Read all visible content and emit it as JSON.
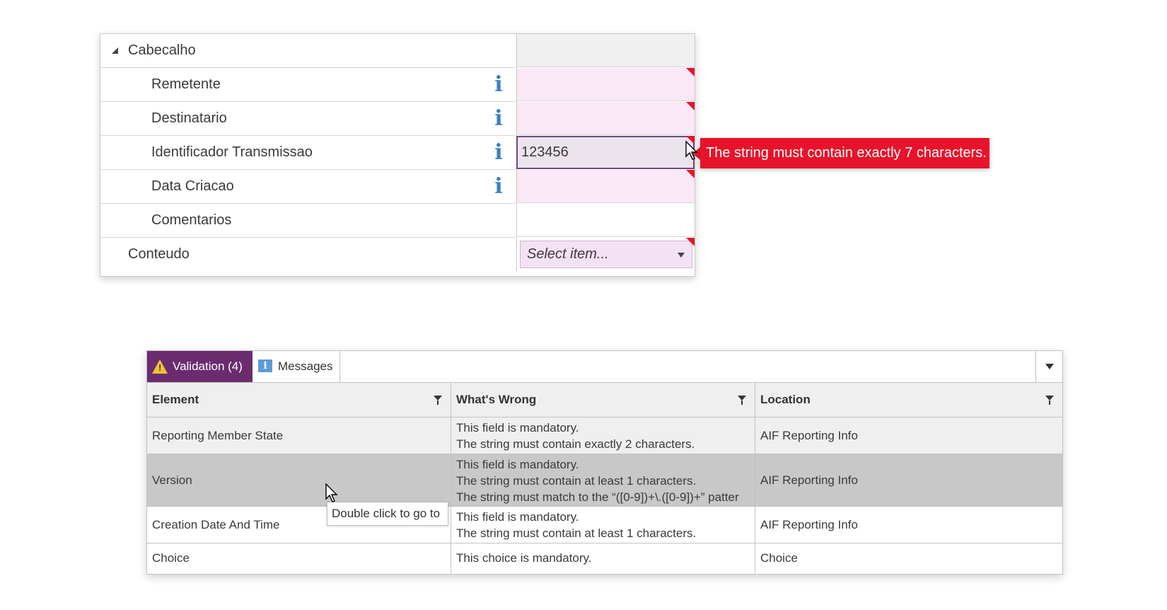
{
  "property_grid": {
    "rows": [
      {
        "label": "Cabecalho",
        "value": ""
      },
      {
        "label": "Remetente",
        "value": ""
      },
      {
        "label": "Destinatario",
        "value": ""
      },
      {
        "label": "Identificador Transmissao",
        "value": "123456"
      },
      {
        "label": "Data Criacao",
        "value": ""
      },
      {
        "label": "Comentarios",
        "value": ""
      },
      {
        "label": "Conteudo",
        "value": ""
      }
    ],
    "combo_placeholder": "Select item...",
    "info_glyph": "i",
    "error_tooltip": "The string must contain exactly 7 characters.",
    "error_color": "#e8132a"
  },
  "validation_panel": {
    "tabs": [
      {
        "label": "Validation (4)",
        "icon": "warning-icon",
        "active": true
      },
      {
        "label": "Messages",
        "icon": "info-icon",
        "active": false
      }
    ],
    "info_glyph": "i",
    "warning_glyph": "!",
    "accent_color": "#6a2c6f",
    "columns": [
      "Element",
      "What's Wrong",
      "Location"
    ],
    "rows": [
      {
        "element": "Reporting Member State",
        "problems": [
          "This field is mandatory.",
          "The string must contain exactly 2 characters."
        ],
        "location": "AIF Reporting Info"
      },
      {
        "element": "Version",
        "problems": [
          "This field is mandatory.",
          "The string must contain at least 1 characters.",
          "The string must match to the “([0-9])+\\.([0-9])+” patter"
        ],
        "location": "AIF Reporting Info"
      },
      {
        "element": "Creation Date And Time",
        "problems": [
          "This field is mandatory.",
          "The string must contain at least 1 characters."
        ],
        "location": "AIF Reporting Info"
      },
      {
        "element": "Choice",
        "problems": [
          "This choice is mandatory."
        ],
        "location": "Choice"
      }
    ],
    "hover_tooltip": "Double click to go to"
  }
}
